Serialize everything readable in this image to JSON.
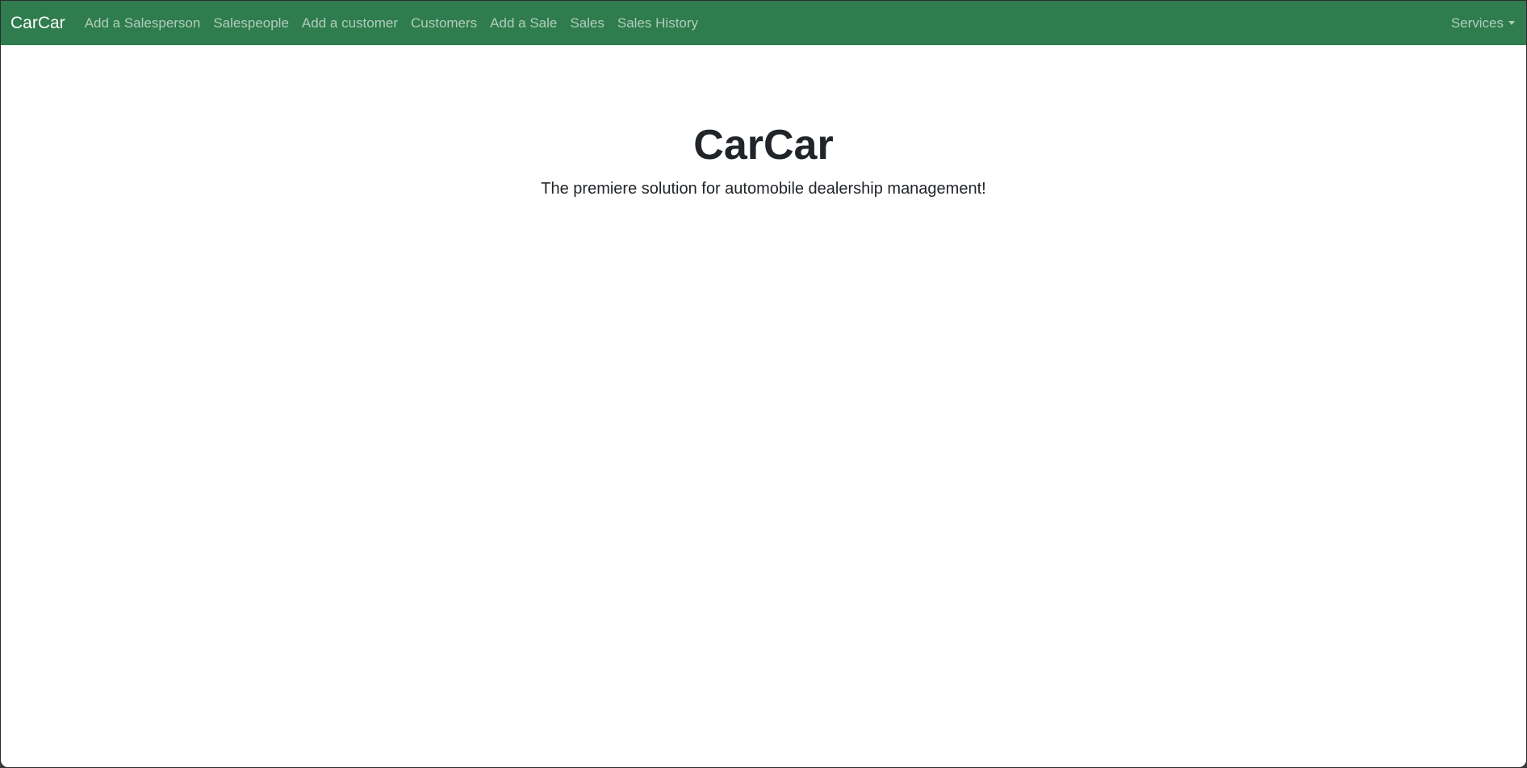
{
  "navbar": {
    "brand": "CarCar",
    "links": [
      {
        "label": "Add a Salesperson"
      },
      {
        "label": "Salespeople"
      },
      {
        "label": "Add a customer"
      },
      {
        "label": "Customers"
      },
      {
        "label": "Add a Sale"
      },
      {
        "label": "Sales"
      },
      {
        "label": "Sales History"
      }
    ],
    "dropdown": {
      "label": "Services",
      "icon": "caret-down-icon"
    },
    "background_color": "#2f7c4e"
  },
  "main": {
    "title": "CarCar",
    "lead": "The premiere solution for automobile dealership management!"
  }
}
